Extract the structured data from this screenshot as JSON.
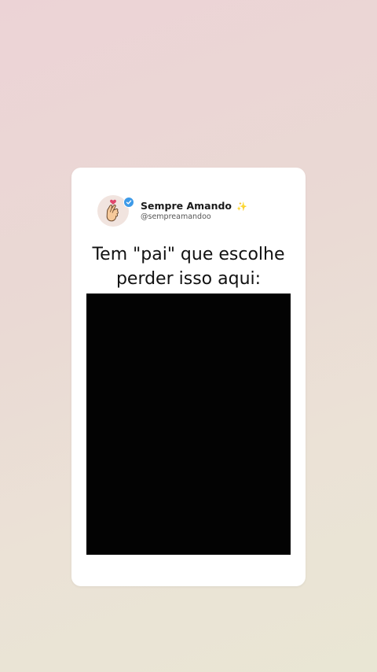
{
  "post": {
    "display_name": "Sempre Amando",
    "name_emoji": "✨",
    "handle": "@sempreamandoo",
    "avatar_icon": "finger-heart-icon",
    "verified_color": "#3d9ae8",
    "caption_line1": "Tem \"pai\" que escolhe",
    "caption_line2": "perder isso aqui:"
  }
}
